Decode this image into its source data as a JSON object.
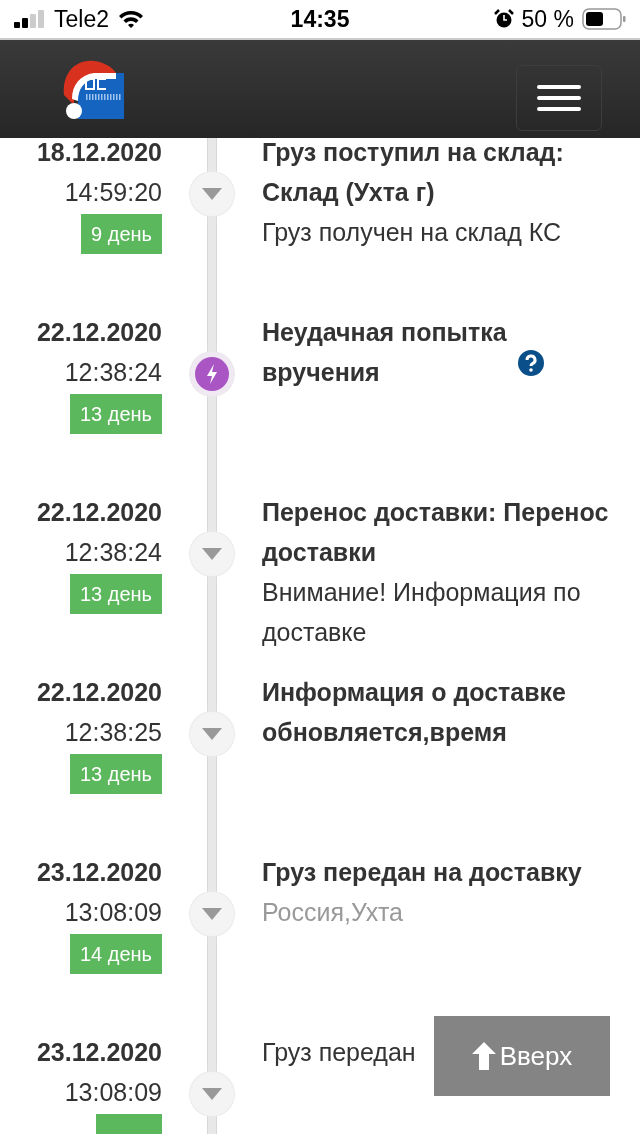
{
  "status_bar": {
    "carrier": "Tele2",
    "time": "14:35",
    "battery": "50 %"
  },
  "events": [
    {
      "date": "18.12.2020",
      "time": "14:59:20",
      "day": "9 день",
      "badge": true,
      "kind": "arrow",
      "title": "Груз поступил на склад: Склад (Ухта г)",
      "details": [
        {
          "kind": "text",
          "text": "Груз получен на склад КС"
        }
      ]
    },
    {
      "date": "22.12.2020",
      "time": "12:38:24",
      "day": "13 день",
      "badge": true,
      "kind": "lightning",
      "title": "Неудачная попытка вручения",
      "help": true
    },
    {
      "date": "22.12.2020",
      "time": "12:38:24",
      "day": "13 день",
      "badge": true,
      "kind": "arrow",
      "title": "Перенос доставки: Перенос доставки",
      "details": [
        {
          "kind": "text",
          "text": "Внимание! Информация по доставке"
        }
      ]
    },
    {
      "date": "22.12.2020",
      "time": "12:38:25",
      "day": "13 день",
      "badge": true,
      "kind": "arrow",
      "title": "Информация о доставке обновляется,время"
    },
    {
      "date": "23.12.2020",
      "time": "13:08:09",
      "day": "14 день",
      "badge": true,
      "kind": "arrow",
      "title": "Груз передан на доставку",
      "details": [
        {
          "kind": "location",
          "text": "Россия,Ухта"
        }
      ]
    },
    {
      "date": "23.12.2020",
      "time": "13:08:09",
      "badge": true,
      "kind": "arrow",
      "details": [
        {
          "kind": "text",
          "text": "Груз передан"
        }
      ]
    }
  ],
  "scroll_top_button": {
    "label": "Вверх"
  }
}
